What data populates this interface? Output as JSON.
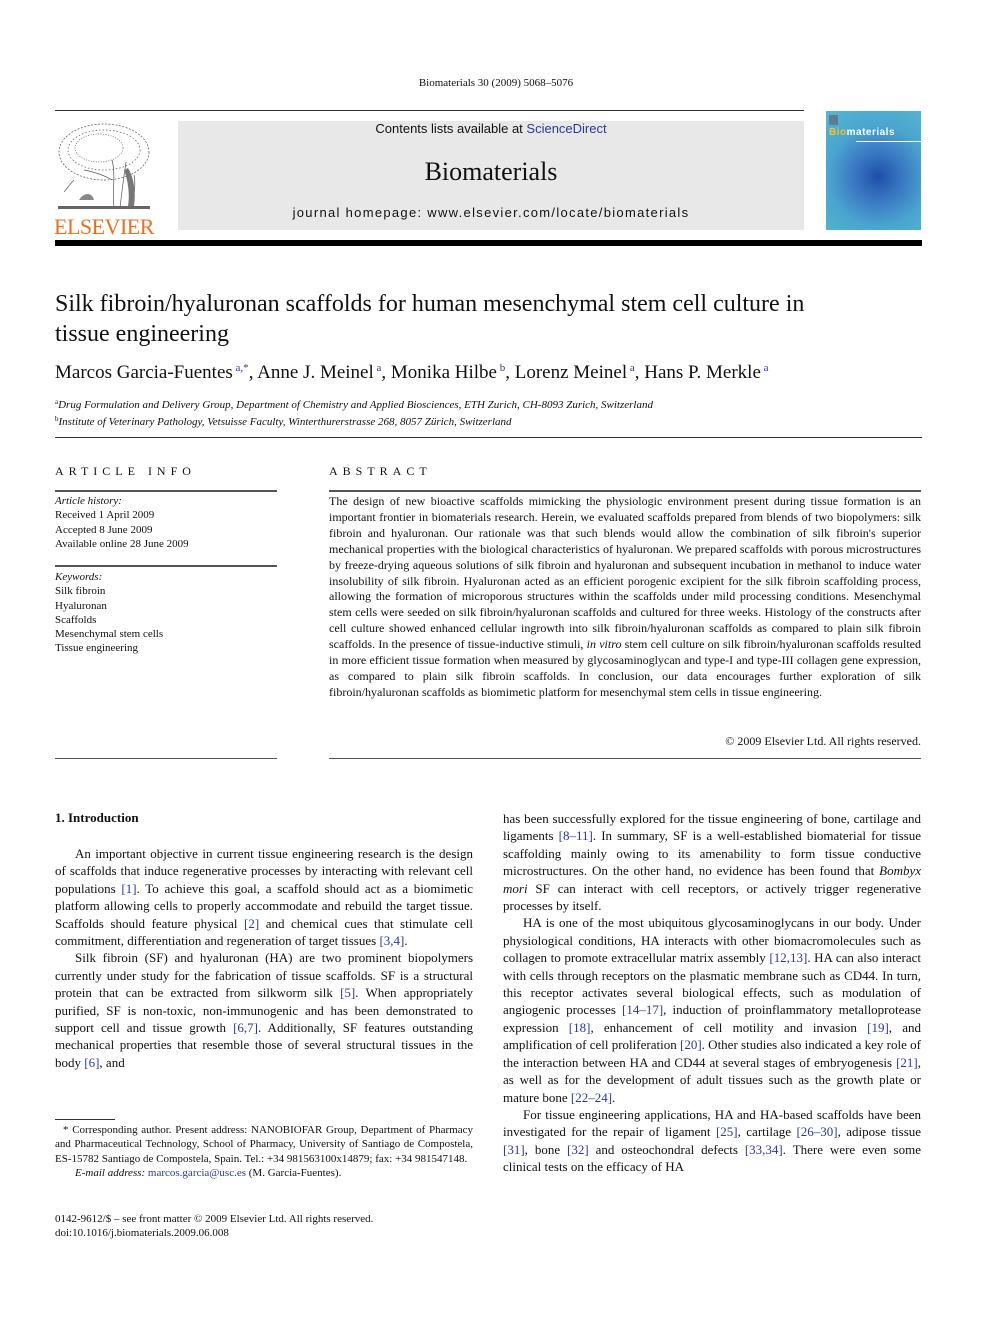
{
  "header": {
    "journal_ref": "Biomaterials 30 (2009) 5068–5076",
    "publisher_logo": "ELSEVIER",
    "contents_prefix": "Contents lists available at ",
    "contents_link": "ScienceDirect",
    "journal_title": "Biomaterials",
    "homepage_label": "journal homepage: ",
    "homepage_url": "www.elsevier.com/locate/biomaterials",
    "cover_title_accent": "Bio",
    "cover_title_rest": "materials"
  },
  "article": {
    "title": "Silk fibroin/hyaluronan scaffolds for human mesenchymal stem cell culture in tissue engineering",
    "authors": [
      {
        "name": "Marcos Garcia-Fuentes",
        "sup": "a,*",
        "sep": ", "
      },
      {
        "name": "Anne J. Meinel",
        "sup": "a",
        "sep": ", "
      },
      {
        "name": "Monika Hilbe",
        "sup": "b",
        "sep": ", "
      },
      {
        "name": "Lorenz Meinel",
        "sup": "a",
        "sep": ", "
      },
      {
        "name": "Hans P. Merkle",
        "sup": "a",
        "sep": ""
      }
    ],
    "affiliations": [
      {
        "mark": "a",
        "text": "Drug Formulation and Delivery Group, Department of Chemistry and Applied Biosciences, ETH Zurich, CH-8093 Zurich, Switzerland"
      },
      {
        "mark": "b",
        "text": "Institute of Veterinary Pathology, Vetsuisse Faculty, Winterthurerstrasse 268, 8057 Zürich, Switzerland"
      }
    ]
  },
  "article_info": {
    "heading": "ARTICLE INFO",
    "history_label": "Article history:",
    "history": [
      "Received 1 April 2009",
      "Accepted 8 June 2009",
      "Available online 28 June 2009"
    ],
    "keywords_label": "Keywords:",
    "keywords": [
      "Silk fibroin",
      "Hyaluronan",
      "Scaffolds",
      "Mesenchymal stem cells",
      "Tissue engineering"
    ]
  },
  "abstract": {
    "heading": "ABSTRACT",
    "text_part1": "The design of new bioactive scaffolds mimicking the physiologic environment present during tissue formation is an important frontier in biomaterials research. Herein, we evaluated scaffolds prepared from blends of two biopolymers: silk fibroin and hyaluronan. Our rationale was that such blends would allow the combination of silk fibroin's superior mechanical properties with the biological characteristics of hyaluronan. We prepared scaffolds with porous microstructures by freeze-drying aqueous solutions of silk fibroin and hyaluronan and subsequent incubation in methanol to induce water insolubility of silk fibroin. Hyaluronan acted as an efficient porogenic excipient for the silk fibroin scaffolding process, allowing the formation of microporous structures within the scaffolds under mild processing conditions. Mesenchymal stem cells were seeded on silk fibroin/hyaluronan scaffolds and cultured for three weeks. Histology of the constructs after cell culture showed enhanced cellular ingrowth into silk fibroin/hyaluronan scaffolds as compared to plain silk fibroin scaffolds. In the presence of tissue-inductive stimuli, ",
    "text_italic": "in vitro",
    "text_part2": " stem cell culture on silk fibroin/hyaluronan scaffolds resulted in more efficient tissue formation when measured by glycosaminoglycan and type-I and type-III collagen gene expression, as compared to plain silk fibroin scaffolds. In conclusion, our data encourages further exploration of silk fibroin/hyaluronan scaffolds as biomimetic platform for mesenchymal stem cells in tissue engineering.",
    "copyright": "© 2009 Elsevier Ltd. All rights reserved."
  },
  "body": {
    "section_heading": "1.  Introduction",
    "left_paragraphs": [
      [
        {
          "t": "An important objective in current tissue engineering research is the design of scaffolds that induce regenerative processes by interacting with relevant cell populations "
        },
        {
          "c": "[1]"
        },
        {
          "t": ". To achieve this goal, a scaffold should act as a biomimetic platform allowing cells to properly accommodate and rebuild the target tissue. Scaffolds should feature physical "
        },
        {
          "c": "[2]"
        },
        {
          "t": " and chemical cues that stimulate cell commitment, differentiation and regeneration of target tissues "
        },
        {
          "c": "[3,4]"
        },
        {
          "t": "."
        }
      ],
      [
        {
          "t": "Silk fibroin (SF) and hyaluronan (HA) are two prominent biopolymers currently under study for the fabrication of tissue scaffolds. SF is a structural protein that can be extracted from silkworm silk "
        },
        {
          "c": "[5]"
        },
        {
          "t": ". When appropriately purified, SF is non-toxic, non-immunogenic and has been demonstrated to support cell and tissue growth "
        },
        {
          "c": "[6,7]"
        },
        {
          "t": ". Additionally, SF features outstanding mechanical properties that resemble those of several structural tissues in the body "
        },
        {
          "c": "[6]"
        },
        {
          "t": ", and"
        }
      ]
    ],
    "right_paragraphs": [
      [
        {
          "t": "has been successfully explored for the tissue engineering of bone, cartilage and ligaments "
        },
        {
          "c": "[8–11]"
        },
        {
          "t": ". In summary, SF is a well-established biomaterial for tissue scaffolding mainly owing to its amenability to form tissue conductive microstructures. On the other hand, no evidence has been found that "
        },
        {
          "i": "Bombyx mori"
        },
        {
          "t": " SF can interact with cell receptors, or actively trigger regenerative processes by itself."
        }
      ],
      [
        {
          "t": "HA is one of the most ubiquitous glycosaminoglycans in our body. Under physiological conditions, HA interacts with other biomacromolecules such as collagen to promote extracellular matrix assembly "
        },
        {
          "c": "[12,13]"
        },
        {
          "t": ". HA can also interact with cells through receptors on the plasmatic membrane such as CD44. In turn, this receptor activates several biological effects, such as modulation of angiogenic processes "
        },
        {
          "c": "[14–17]"
        },
        {
          "t": ", induction of proinflammatory metalloprotease expression "
        },
        {
          "c": "[18]"
        },
        {
          "t": ", enhancement of cell motility and invasion "
        },
        {
          "c": "[19]"
        },
        {
          "t": ", and amplification of cell proliferation "
        },
        {
          "c": "[20]"
        },
        {
          "t": ". Other studies also indicated a key role of the interaction between HA and CD44 at several stages of embryogenesis "
        },
        {
          "c": "[21]"
        },
        {
          "t": ", as well as for the development of adult tissues such as the growth plate or mature bone "
        },
        {
          "c": "[22–24]"
        },
        {
          "t": "."
        }
      ],
      [
        {
          "t": "For tissue engineering applications, HA and HA-based scaffolds have been investigated for the repair of ligament "
        },
        {
          "c": "[25]"
        },
        {
          "t": ", cartilage "
        },
        {
          "c": "[26–30]"
        },
        {
          "t": ", adipose tissue "
        },
        {
          "c": "[31]"
        },
        {
          "t": ", bone "
        },
        {
          "c": "[32]"
        },
        {
          "t": " and osteochondral defects "
        },
        {
          "c": "[33,34]"
        },
        {
          "t": ". There were even some clinical tests on the efficacy of HA"
        }
      ]
    ]
  },
  "footnote": {
    "corresponding": "* Corresponding author. Present address: NANOBIOFAR Group, Department of Pharmacy and Pharmaceutical Technology, School of Pharmacy, University of Santiago de Compostela, ES-15782 Santiago de Compostela, Spain. Tel.: +34 981563100x14879; fax: +34 981547148.",
    "email_label": "E-mail address: ",
    "email": "marcos.garcia@usc.es",
    "email_suffix": " (M. Garcia-Fuentes).",
    "front_matter": "0142-9612/$ – see front matter © 2009 Elsevier Ltd. All rights reserved.",
    "doi": "doi:10.1016/j.biomaterials.2009.06.008"
  },
  "colors": {
    "link": "#2a3a9a",
    "elsevier_orange": "#e8701e",
    "banner_gray": "#e8e8e8"
  }
}
